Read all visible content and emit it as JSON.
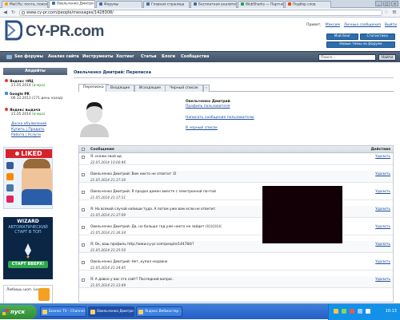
{
  "browser": {
    "tabs": [
      {
        "label": "Mail.Ru: почта, поиск",
        "color": "#f7a51b"
      },
      {
        "label": "Овельченко Дмитри",
        "color": "#3b6ea8"
      },
      {
        "label": "Форумы",
        "color": "#3b6ea8"
      },
      {
        "label": "Главная страница",
        "color": "#3b6ea8"
      },
      {
        "label": "Бесплатная аналити",
        "color": "#3b6ea8"
      },
      {
        "label": "WebSharks — Партне",
        "color": "#2d9c5a"
      },
      {
        "label": "Подбор слов",
        "color": "#e64a19"
      }
    ],
    "url": "www.cy-pr.com/people/messages/1428308/"
  },
  "header": {
    "logo_text": "CY-PR.com",
    "greeting": "Привет,",
    "username": "Максим",
    "personal_messages": "Личные сообщения",
    "logout": "Выйти",
    "blog_button": "Мой блог",
    "stats_button": "Статистика",
    "new_topics_button": "Новые темы на форуме"
  },
  "nav": {
    "items": [
      "Seo форумы",
      "Анализ сайта",
      "Инструменты",
      "Хостинг",
      "Статьи",
      "Блоги",
      "Сообщества"
    ],
    "search_placeholder": "Поиск...",
    "search_button": "Найти"
  },
  "sidebar": {
    "title": "Апдейты",
    "updates": [
      {
        "name": "Яндекс тИЦ",
        "date": "21.05.2014",
        "note": "(вчера)"
      },
      {
        "name": "Google PR",
        "date": "06.12.2013",
        "note": "(171 день назад)"
      },
      {
        "name": "Яндекс выдача",
        "date": "21.05.2014",
        "note": "(вчера)"
      }
    ],
    "links": [
      "Доска объявлений",
      "Купить | Продать",
      "Работа | Услуги"
    ],
    "ad1_title": "LIKED",
    "ad2_title": "WIZARD",
    "ad2_sub": "АВТОМАТИЧЕСКИЙ СТАРТ В ТОП",
    "ad2_cta": "СТАРТ ВВЕРХ!",
    "ad3_text": "Любишь шоп. Love is..."
  },
  "page": {
    "breadcrumb": "Овельченко Дмитрий: Переписка",
    "tabs": [
      "Переписка",
      "Входящие",
      "Исходящие",
      "Черный список"
    ],
    "profile_name": "Овельченко Дмитрий",
    "profile_link": "Профиль пользователя",
    "write_link": "Написать сообщение пользователю",
    "blacklist_link": "В черный список",
    "col_message": "Сообщение",
    "col_actions": "Действия",
    "delete_label": "Удалить",
    "messages": [
      {
        "text": "Я: скажи свой ид",
        "date": "22.05.2014 10:00:46"
      },
      {
        "text": "Овельченко Дмитрий: Вам никто не ответит :D",
        "date": "21.05.2014 21:37:30"
      },
      {
        "text": "Овельченко Дмитрий: Я продал домен вместе с электронной почтой",
        "date": "21.05.2014 21:37:31"
      },
      {
        "text": "Я: На всякий случай напиши туда. А потом уже вам если не ответит.",
        "date": "21.05.2014 21:37:09"
      },
      {
        "text": "Овельченко Дмитрий: Да, но больше год уже никто не зайдет ((((((((((((",
        "date": "21.05.2014 21:36:24"
      },
      {
        "text": "Я: Ок, ваш профиль http://www.cy-pr.com/people/144784/?",
        "date": "21.05.2014 21:35:50"
      },
      {
        "text": "Овельченко Дмитрий: Нет, купил недавно",
        "date": "21.05.2014 21:34:45"
      },
      {
        "text": "Я: А давно у вас это сайт? Последний вопрос.",
        "date": "21.05.2014 21:33:49"
      }
    ]
  },
  "taskbar": {
    "start": "пуск",
    "items": [
      "Бизнес TV - Channel...",
      "Овельченко Дмитри...",
      "Яндекс.Вебмастер -..."
    ],
    "clock": "10:13"
  }
}
